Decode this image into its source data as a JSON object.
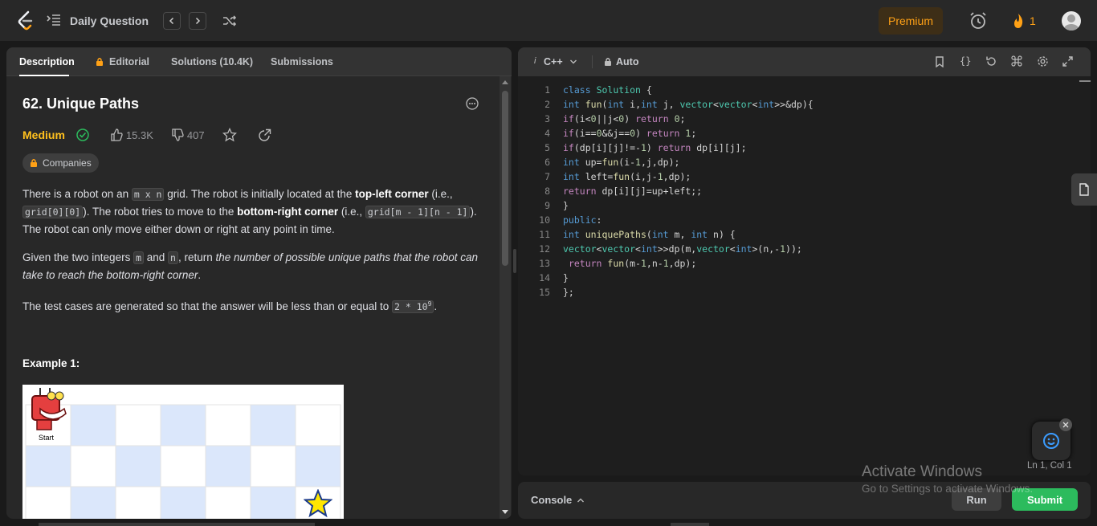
{
  "topbar": {
    "title": "Daily Question",
    "premium": "Premium",
    "streak": "1"
  },
  "tabs": [
    {
      "label": "Description"
    },
    {
      "label": "Editorial"
    },
    {
      "label": "Solutions (10.4K)"
    },
    {
      "label": "Submissions"
    }
  ],
  "problem": {
    "title": "62. Unique Paths",
    "difficulty": "Medium",
    "likes": "15.3K",
    "dislikes": "407",
    "companies": "Companies",
    "p1_a": "There is a robot on an ",
    "p1_code1": "m x n",
    "p1_b": " grid. The robot is initially located at the ",
    "p1_bold1": "top-left corner",
    "p1_c": " (i.e., ",
    "p1_code2": "grid[0][0]",
    "p1_d": "). The robot tries to move to the ",
    "p1_bold2": "bottom-right corner",
    "p1_e": " (i.e., ",
    "p1_code3": "grid[m - 1][n - 1]",
    "p1_f": "). The robot can only move either down or right at any point in time.",
    "p2_a": "Given the two integers ",
    "p2_code1": "m",
    "p2_b": " and ",
    "p2_code2": "n",
    "p2_c": ", return ",
    "p2_italic": "the number of possible unique paths that the robot can take to reach the bottom-right corner",
    "p2_d": ".",
    "p3_a": "The test cases are generated so that the answer will be less than or equal to ",
    "p3_code": "2 * 10",
    "p3_sup": "9",
    "p3_b": ".",
    "example_title": "Example 1:",
    "start_label": "Start"
  },
  "editor": {
    "language": "C++",
    "mode": "Auto",
    "lines": [
      "class Solution {",
      "int fun(int i,int j, vector<vector<int>>&dp){",
      "if(i<0||j<0) return 0;",
      "if(i==0&&j==0) return 1;",
      "if(dp[i][j]!=-1) return dp[i][j];",
      "int up=fun(i-1,j,dp);",
      "int left=fun(i,j-1,dp);",
      "return dp[i][j]=up+left;;",
      "}",
      "public:",
      "int uniquePaths(int m, int n) {",
      "vector<vector<int>>dp(m,vector<int>(n,-1));",
      " return fun(m-1,n-1,dp);",
      "}",
      "};"
    ],
    "line_numbers": [
      "1",
      "2",
      "3",
      "4",
      "5",
      "6",
      "7",
      "8",
      "9",
      "10",
      "11",
      "12",
      "13",
      "14",
      "15"
    ],
    "cursor": "Ln 1, Col 1"
  },
  "console": {
    "label": "Console",
    "run": "Run",
    "submit": "Submit"
  },
  "watermark": {
    "line1": "Activate Windows",
    "line2": "Go to Settings to activate Windows."
  }
}
